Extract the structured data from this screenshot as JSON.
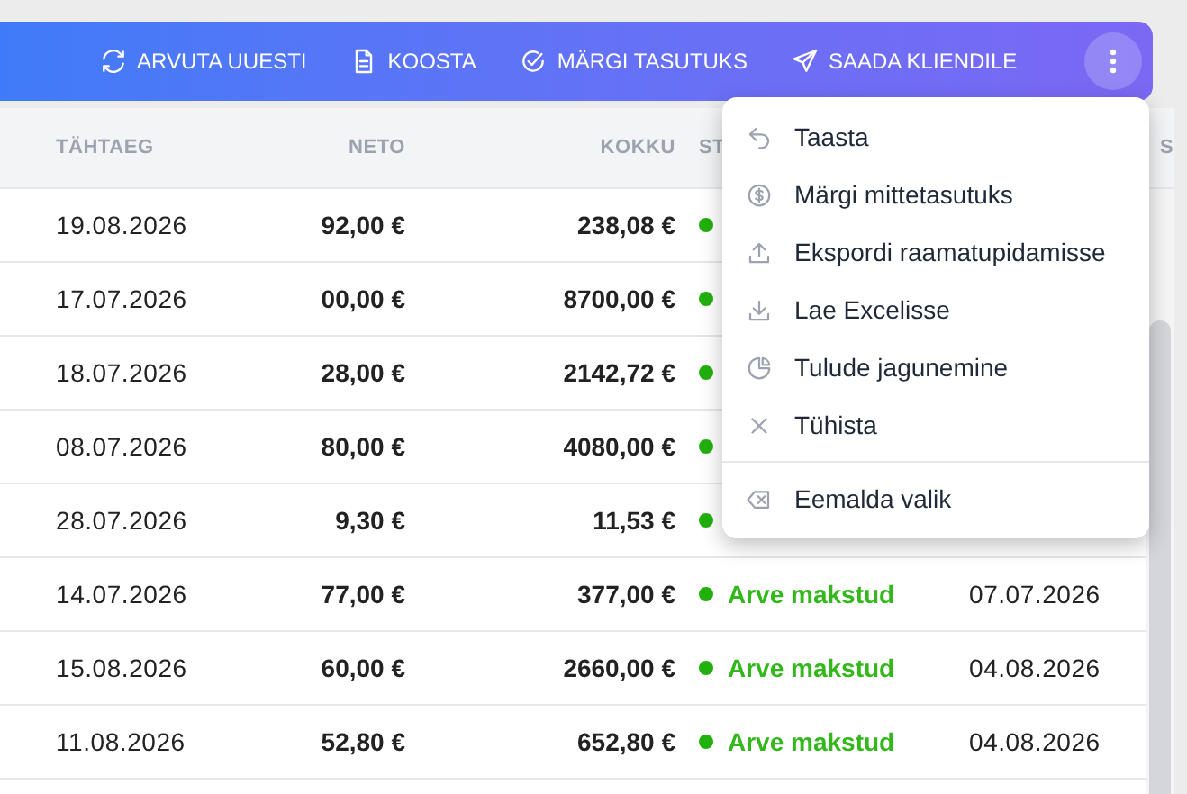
{
  "toolbar": {
    "buttons": [
      {
        "label": "ARVUTA UUESTI"
      },
      {
        "label": "KOOSTA"
      },
      {
        "label": "MÄRGI TASUTUKS"
      },
      {
        "label": "SAADA KLIENDILE"
      }
    ]
  },
  "table": {
    "columns": [
      "TÄHTAEG",
      "NETO",
      "KOKKU",
      "ST",
      "S"
    ],
    "rows": [
      {
        "due": "19.08.2026",
        "net": "92,00 €",
        "total": "238,08 €"
      },
      {
        "due": "17.07.2026",
        "net": "00,00 €",
        "total": "8700,00 €"
      },
      {
        "due": "18.07.2026",
        "net": "28,00 €",
        "total": "2142,72 €"
      },
      {
        "due": "08.07.2026",
        "net": "80,00 €",
        "total": "4080,00 €"
      },
      {
        "due": "28.07.2026",
        "net": "9,30 €",
        "total": "11,53 €"
      },
      {
        "due": "14.07.2026",
        "net": "77,00 €",
        "total": "377,00 €",
        "status": "Arve makstud",
        "date": "07.07.2026"
      },
      {
        "due": "15.08.2026",
        "net": "60,00 €",
        "total": "2660,00 €",
        "status": "Arve makstud",
        "date": "04.08.2026"
      },
      {
        "due": "11.08.2026",
        "net": "52,80 €",
        "total": "652,80 €",
        "status": "Arve makstud",
        "date": "04.08.2026"
      }
    ]
  },
  "menu": {
    "items": [
      {
        "kind": "item",
        "label": "Taasta"
      },
      {
        "kind": "item",
        "label": "Märgi mittetasutuks"
      },
      {
        "kind": "item",
        "label": "Ekspordi raamatupidamisse"
      },
      {
        "kind": "item",
        "label": "Lae Excelisse"
      },
      {
        "kind": "item",
        "label": "Tulude jagunemine"
      },
      {
        "kind": "item",
        "label": "Tühista"
      },
      {
        "kind": "divider"
      },
      {
        "kind": "item",
        "label": "Eemalda valik"
      }
    ]
  }
}
